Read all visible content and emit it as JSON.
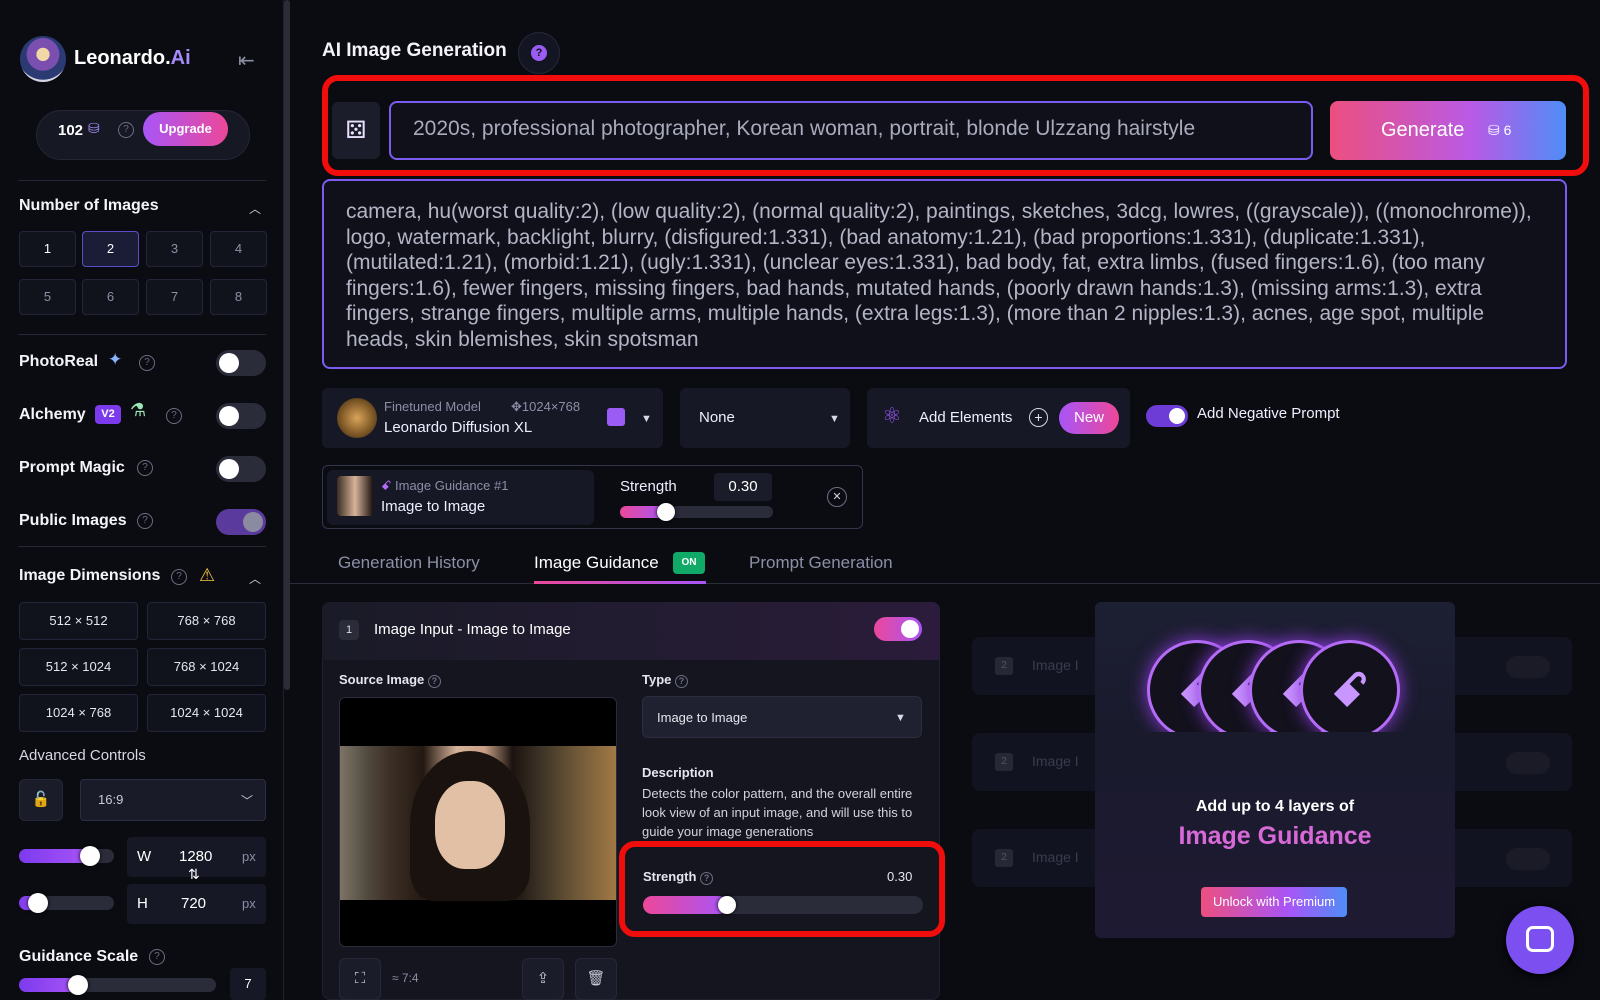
{
  "brand": {
    "name_main": "Leonardo.",
    "name_ai": "Ai",
    "collapse_icon": "collapse-left-icon"
  },
  "credits": {
    "count": "102",
    "upgrade_label": "Upgrade"
  },
  "sidebar": {
    "num_images_title": "Number of Images",
    "num_images": [
      "1",
      "2",
      "3",
      "4",
      "5",
      "6",
      "7",
      "8"
    ],
    "num_images_selected": "2",
    "photoreal_label": "PhotoReal",
    "alchemy_label": "Alchemy",
    "alchemy_badge": "V2",
    "prompt_magic_label": "Prompt Magic",
    "public_images_label": "Public Images",
    "image_dimensions_title": "Image Dimensions",
    "dimensions": [
      "512 × 512",
      "768 × 768",
      "512 × 1024",
      "768 × 1024",
      "1024 × 768",
      "1024 × 1024"
    ],
    "advanced_controls_label": "Advanced Controls",
    "aspect_ratio": "16:9",
    "width_label": "W",
    "width_value": "1280",
    "width_unit": "px",
    "width_slider": 0.75,
    "height_label": "H",
    "height_value": "720",
    "height_unit": "px",
    "height_slider": 0.2,
    "guidance_scale_label": "Guidance Scale",
    "guidance_scale_value": "7",
    "guidance_slider": 0.3
  },
  "main": {
    "title": "AI Image Generation",
    "prompt": "2020s, professional photographer, Korean woman, portrait, blonde Ulzzang hairstyle",
    "generate_label": "Generate",
    "generate_cost": "6",
    "negative_prompt": "camera, hu(worst quality:2), (low quality:2), (normal quality:2), paintings, sketches, 3dcg, lowres, ((grayscale)), ((monochrome)), logo, watermark, backlight, blurry, (disfigured:1.331), (bad anatomy:1.21), (bad proportions:1.331), (duplicate:1.331), (mutilated:1.21), (morbid:1.21), (ugly:1.331), (unclear eyes:1.331), bad body, fat, extra limbs, (fused fingers:1.6), (too many fingers:1.6), fewer fingers, missing fingers, bad hands, mutated hands, (poorly drawn hands:1.3), (missing arms:1.3), extra fingers, strange fingers, multiple arms, multiple hands, (extra legs:1.3), (more than 2 nipples:1.3), acnes, age spot, multiple heads, skin blemishes, skin spotsman",
    "model_caption": "Finetuned Model",
    "model_dims": "1024×768",
    "model_name": "Leonardo Diffusion XL",
    "style_value": "None",
    "add_elements_label": "Add Elements",
    "new_badge": "New",
    "add_negative_label": "Add Negative Prompt",
    "guidance_chip_caption": "Image Guidance #1",
    "guidance_chip_title": "Image to Image",
    "strength_label": "Strength",
    "strength_value": "0.30",
    "strength_fraction": 0.3
  },
  "tabs": {
    "history": "Generation History",
    "guidance": "Image Guidance",
    "guidance_badge": "ON",
    "prompt_gen": "Prompt Generation"
  },
  "guidance_panel": {
    "index": "1",
    "title": "Image Input - Image to Image",
    "source_label": "Source Image",
    "type_label": "Type",
    "type_value": "Image to Image",
    "description_label": "Description",
    "description": "Detects the color pattern, and the overall entire look view of an input image, and will use this to guide your image generations",
    "strength_label": "Strength",
    "strength_value": "0.30",
    "strength_fraction": 0.3,
    "ratio_text": "≈ 7:4"
  },
  "ghost_rows": {
    "index": "2",
    "label": "Image I"
  },
  "promo": {
    "line1": "Add up to 4 layers of",
    "line2": "Image Guidance",
    "cta": "Unlock with Premium"
  },
  "colors": {
    "accent": "#7c5cf0",
    "highlight": "#f20d0d",
    "pink": "#ec4899",
    "bg": "#0b0c12"
  }
}
